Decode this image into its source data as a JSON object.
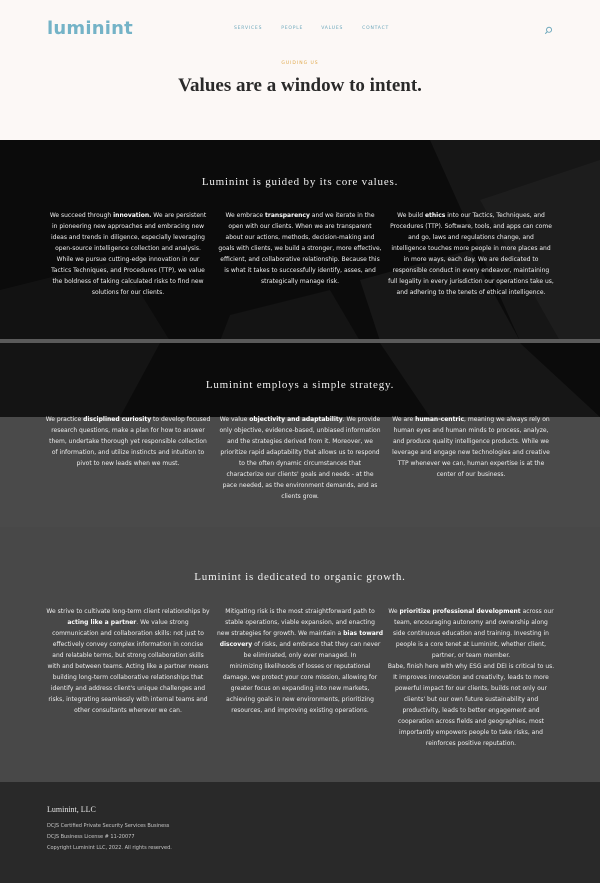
{
  "header": {
    "logo": "luminint",
    "nav": [
      "SERVICES",
      "PEOPLE",
      "VALUES",
      "CONTACT"
    ],
    "search_icon": "search-icon",
    "eyebrow": "GUIDING US",
    "title": "Values are a window to intent."
  },
  "sections": [
    {
      "title": "Luminint is guided by its core values.",
      "columns": [
        {
          "lines": [
            [
              "We succeed through ",
              "innovation.",
              "  We are persistent"
            ],
            [
              "in pioneering new approaches and embracing new"
            ],
            [
              "ideas and trends in diligence, especially leveraging"
            ],
            [
              "open-source intelligence collection and analysis."
            ],
            [
              "While we pursue cutting-edge innovation in our"
            ],
            [
              "Tactics Techniques, and Procedures (TTP), we value"
            ],
            [
              "the boldness of taking calculated risks to find new"
            ],
            [
              "solutions for our clients."
            ]
          ]
        },
        {
          "lines": [
            [
              "We embrace ",
              "transparency",
              " and we iterate in the"
            ],
            [
              "open with our clients.  When we are transparent"
            ],
            [
              "about our actions, methods, decision-making and"
            ],
            [
              "goals with clients, we build a stronger, more effective,"
            ],
            [
              "efficient, and collaborative relationship. Because this"
            ],
            [
              "is what it takes to successfully identify, asses, and"
            ],
            [
              "strategically manage risk."
            ]
          ]
        },
        {
          "lines": [
            [
              "We build ",
              "ethics",
              " into our Tactics, Techniques, and"
            ],
            [
              "Procedures (TTP). Software, tools, and apps can come"
            ],
            [
              "and go, laws and regulations change, and"
            ],
            [
              "intelligence touches more people in more places and"
            ],
            [
              "in more ways, each day. We are dedicated to"
            ],
            [
              "responsible conduct in every endeavor, maintaining"
            ],
            [
              "full legality in every jurisdiction our operations take us,"
            ],
            [
              "and adhering to the tenets of ethical intelligence."
            ]
          ]
        }
      ]
    },
    {
      "title": "Luminint employs a simple strategy.",
      "columns": [
        {
          "lines": [
            [
              "We practice ",
              "disciplined curiosity",
              " to develop focused"
            ],
            [
              "research questions, make a plan for how to answer"
            ],
            [
              "them, undertake thorough yet responsible collection"
            ],
            [
              "of information, and utilize instincts and intuition to"
            ],
            [
              "pivot to new leads when we must."
            ]
          ]
        },
        {
          "lines": [
            [
              "We value ",
              "objectivity and adaptability",
              ". We provide"
            ],
            [
              "only objective, evidence-based, unbiased information"
            ],
            [
              "and the strategies derived from it. Moreover, we"
            ],
            [
              "prioritize rapid adaptability that allows us to respond"
            ],
            [
              "to the often dynamic circumstances that"
            ],
            [
              "characterize our clients' goals and needs - at the"
            ],
            [
              "pace needed, as the environment demands, and as"
            ],
            [
              "clients grow."
            ]
          ]
        },
        {
          "lines": [
            [
              "We are ",
              "human-centric",
              ", meaning we always rely on"
            ],
            [
              "human eyes and human minds to process, analyze,"
            ],
            [
              "and produce quality intelligence products. While we"
            ],
            [
              "leverage and engage new technologies and creative"
            ],
            [
              "TTP whenever we can, human expertise is at the"
            ],
            [
              "center of our business."
            ]
          ]
        }
      ]
    },
    {
      "title": "Luminint is dedicated to organic growth.",
      "columns": [
        {
          "lines": [
            [
              "We strive to cultivate long-term client relationships by"
            ],
            [
              "",
              "acting like a partner",
              ". We value strong"
            ],
            [
              "communication and collaboration skills: not just to"
            ],
            [
              "effectively convey complex information in concise"
            ],
            [
              "and relatable terms, but strong collaboration skills"
            ],
            [
              "with and between teams. Acting like a partner means"
            ],
            [
              "building long-term collaborative relationships that"
            ],
            [
              "identify and address client's unique challenges and"
            ],
            [
              "risks, integrating seamlessly with internal teams and"
            ],
            [
              "other consultants wherever we can."
            ]
          ]
        },
        {
          "lines": [
            [
              "Mitigating risk is the most straightforward path to"
            ],
            [
              "stable operations, viable expansion, and enacting"
            ],
            [
              "new strategies for growth. We maintain a ",
              "bias toward",
              ""
            ],
            [
              "",
              "discovery",
              " of risks, and embrace that they can never"
            ],
            [
              "be eliminated, only ever managed. In"
            ],
            [
              "minimizing likelihoods of losses or reputational"
            ],
            [
              "damage, we protect your core mission, allowing for"
            ],
            [
              "greater focus on expanding into new markets,"
            ],
            [
              "achieving goals in new environments, prioritizing"
            ],
            [
              "resources, and improving existing operations."
            ]
          ]
        },
        {
          "lines": [
            [
              "We ",
              "prioritize professional development",
              " across our"
            ],
            [
              "team, encouraging autonomy and ownership along"
            ],
            [
              "side continuous education and training. Investing in"
            ],
            [
              "people is a core tenet at Luminint, whether client,"
            ],
            [
              "partner, or team member."
            ],
            [
              "Babe, finish here with why ESG and DEI is critical to us."
            ],
            [
              "It improves innovation and creativity, leads to more"
            ],
            [
              "powerful impact for our clients, builds not only our"
            ],
            [
              "clients' but our own future sustainability and"
            ],
            [
              "productivity, leads to better engagement and"
            ],
            [
              "cooperation across fields and geographies, most"
            ],
            [
              "importantly empowers people to take risks, and"
            ],
            [
              "reinforces positive reputation."
            ]
          ]
        }
      ]
    }
  ],
  "footer": {
    "company": "Luminint, LLC",
    "lines": [
      "DCJS Certified Private Security Services Business",
      "DCJS Business License # 11-20077",
      "Copyright Luminint LLC, 2022.  All rights reserved."
    ]
  }
}
